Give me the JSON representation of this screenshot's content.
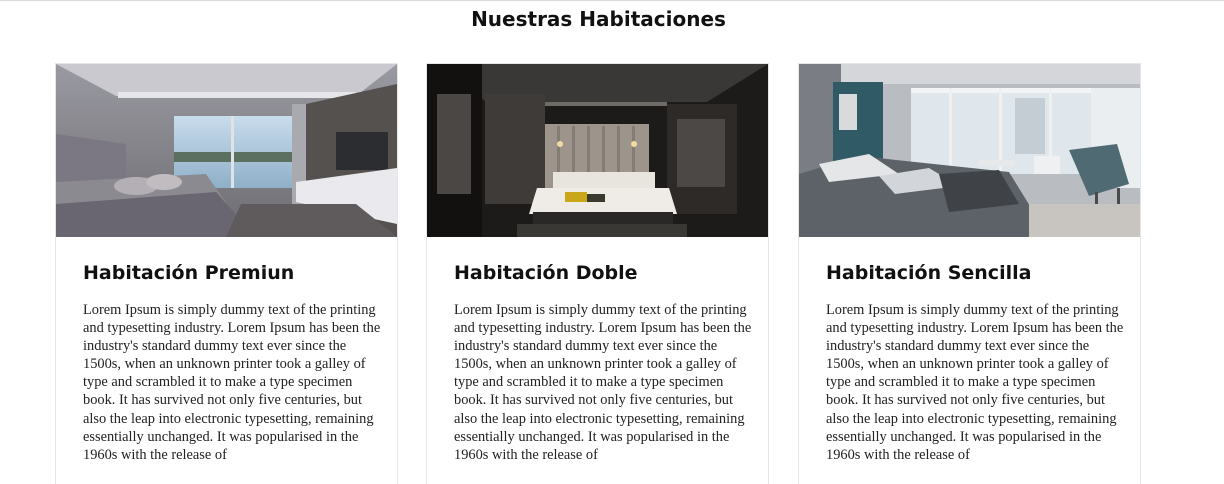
{
  "section": {
    "title": "Nuestras Habitaciones"
  },
  "rooms": [
    {
      "title": "Habitación Premiun",
      "description": "Lorem Ipsum is simply dummy text of the printing and typesetting industry. Lorem Ipsum has been the industry's standard dummy text ever since the 1500s, when an unknown printer took a galley of type and scrambled it to make a type specimen book. It has survived not only five centuries, but also the leap into electronic typesetting, remaining essentially unchanged. It was popularised in the 1960s with the release of"
    },
    {
      "title": "Habitación Doble",
      "description": "Lorem Ipsum is simply dummy text of the printing and typesetting industry. Lorem Ipsum has been the industry's standard dummy text ever since the 1500s, when an unknown printer took a galley of type and scrambled it to make a type specimen book. It has survived not only five centuries, but also the leap into electronic typesetting, remaining essentially unchanged. It was popularised in the 1960s with the release of"
    },
    {
      "title": "Habitación Sencilla",
      "description": "Lorem Ipsum is simply dummy text of the printing and typesetting industry. Lorem Ipsum has been the industry's standard dummy text ever since the 1500s, when an unknown printer took a galley of type and scrambled it to make a type specimen book. It has survived not only five centuries, but also the leap into electronic typesetting, remaining essentially unchanged. It was popularised in the 1960s with the release of"
    }
  ]
}
